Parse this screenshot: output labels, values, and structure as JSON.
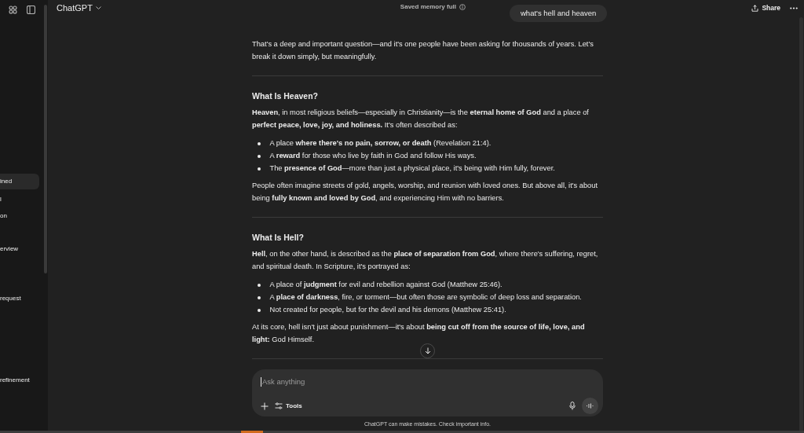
{
  "sidebar": {
    "items": [
      {
        "label": "ined",
        "selected": true
      },
      {
        "label": "l",
        "selected": false
      },
      {
        "label": "on",
        "selected": false
      },
      {
        "label": "erview",
        "selected": false
      },
      {
        "label": "request",
        "selected": false
      },
      {
        "label": "refinement",
        "selected": false
      }
    ]
  },
  "header": {
    "title": "ChatGPT",
    "memory_notice": "Saved memory full",
    "share": "Share"
  },
  "user_message": "what's hell and heaven",
  "response": [
    {
      "kind": "paragraph",
      "text": "That's a deep and important question—and it's one people have been asking for thousands of years. Let's break it down simply, but meaningfully."
    },
    {
      "kind": "divider"
    },
    {
      "kind": "heading",
      "text": "What Is Heaven?"
    },
    {
      "kind": "paragraph",
      "text": "**Heaven**, in most religious beliefs—especially in Christianity—is the **eternal home of God** and a place of **perfect peace, love, joy, and holiness.** It's often described as:"
    },
    {
      "kind": "list",
      "items": [
        "A place **where there's no pain, sorrow, or death** (Revelation 21:4).",
        "A **reward** for those who live by faith in God and follow His ways.",
        "The **presence of God**—more than just a physical place, it's being with Him fully, forever."
      ]
    },
    {
      "kind": "paragraph",
      "text": "People often imagine streets of gold, angels, worship, and reunion with loved ones. But above all, it's about being **fully known and loved by God**, and experiencing Him with no barriers."
    },
    {
      "kind": "divider"
    },
    {
      "kind": "heading",
      "text": "What Is Hell?"
    },
    {
      "kind": "paragraph",
      "text": "**Hell**, on the other hand, is described as the **place of separation from God**, where there's suffering, regret, and spiritual death. In Scripture, it's portrayed as:"
    },
    {
      "kind": "list",
      "items": [
        "A place of **judgment** for evil and rebellion against God (Matthew 25:46).",
        "A **place of darkness**, fire, or torment—but often those are symbolic of deep loss and separation.",
        "Not created for people, but for the devil and his demons (Matthew 25:41)."
      ]
    },
    {
      "kind": "paragraph",
      "text": "At its core, hell isn't just about punishment—it's about **being cut off from the source of life, love, and light:** God Himself."
    },
    {
      "kind": "divider"
    }
  ],
  "composer": {
    "placeholder": "Ask anything",
    "tools": "Tools"
  },
  "disclaimer": "ChatGPT can make mistakes. Check important info."
}
